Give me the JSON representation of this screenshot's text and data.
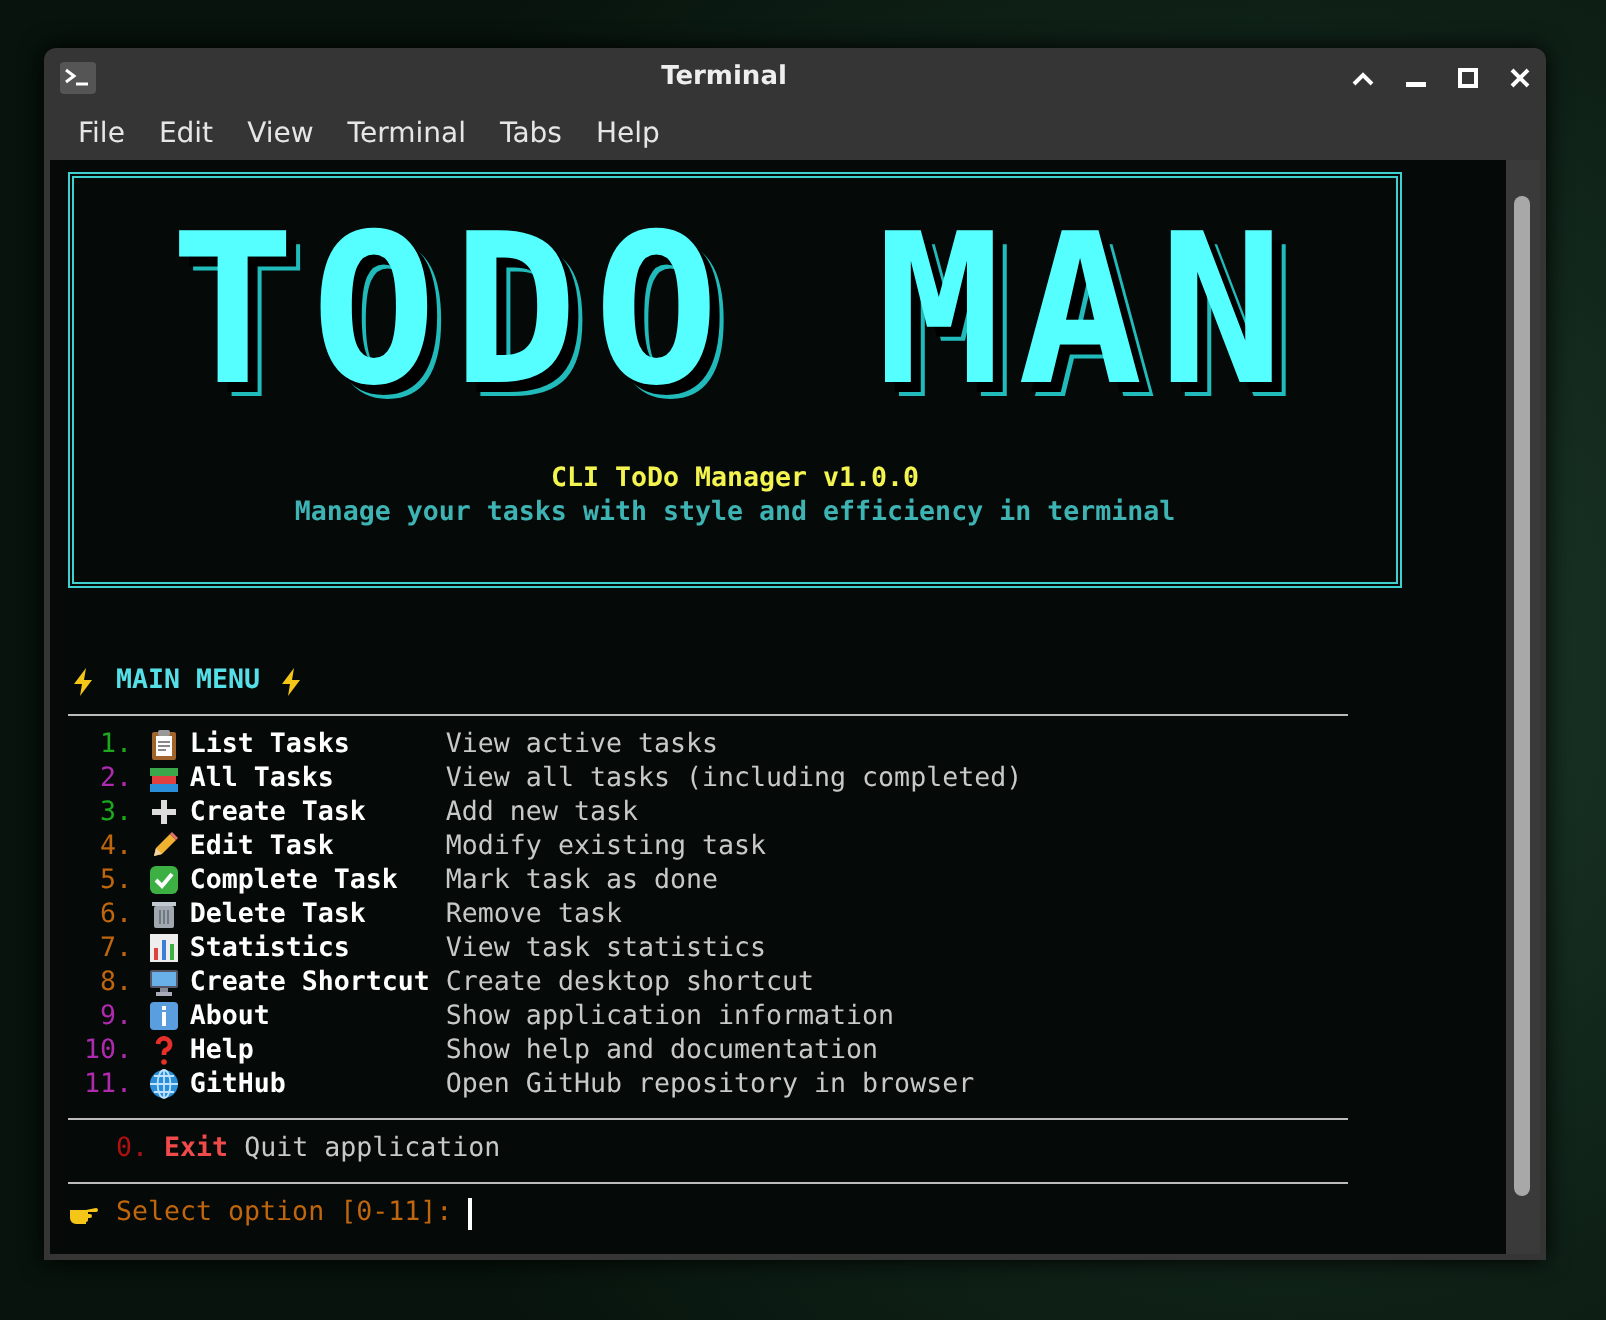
{
  "window": {
    "title": "Terminal"
  },
  "menu": [
    "File",
    "Edit",
    "View",
    "Terminal",
    "Tabs",
    "Help"
  ],
  "banner": {
    "logo": "TODO MAN",
    "title": "CLI ToDo Manager v1.0.0",
    "subtitle": "Manage your tasks with style and efficiency in terminal"
  },
  "main_menu": {
    "heading": "MAIN MENU",
    "items": [
      {
        "number": "1.",
        "label": "List Tasks",
        "description": "View active tasks",
        "color": "#1ea81e"
      },
      {
        "number": "2.",
        "label": "All Tasks",
        "description": "View all tasks (including completed)",
        "color": "#b02ab0"
      },
      {
        "number": "3.",
        "label": "Create Task",
        "description": "Add new task",
        "color": "#1ea81e"
      },
      {
        "number": "4.",
        "label": "Edit Task",
        "description": "Modify existing task",
        "color": "#c0660c"
      },
      {
        "number": "5.",
        "label": "Complete Task",
        "description": "Mark task as done",
        "color": "#c0660c"
      },
      {
        "number": "6.",
        "label": "Delete Task",
        "description": "Remove task",
        "color": "#c0660c"
      },
      {
        "number": "7.",
        "label": "Statistics",
        "description": "View task statistics",
        "color": "#c0660c"
      },
      {
        "number": "8.",
        "label": "Create Shortcut",
        "description": "Create desktop shortcut",
        "color": "#c0660c"
      },
      {
        "number": "9.",
        "label": "About",
        "description": "Show application information",
        "color": "#b02ab0"
      },
      {
        "number": "10.",
        "label": "Help",
        "description": "Show help and documentation",
        "color": "#b02ab0"
      },
      {
        "number": "11.",
        "label": "GitHub",
        "description": "Open GitHub repository in browser",
        "color": "#b02ab0"
      }
    ],
    "exit": {
      "number": "0.",
      "label": "Exit",
      "description": "Quit application"
    }
  },
  "prompt": {
    "text": "Select option [0-11]:"
  }
}
